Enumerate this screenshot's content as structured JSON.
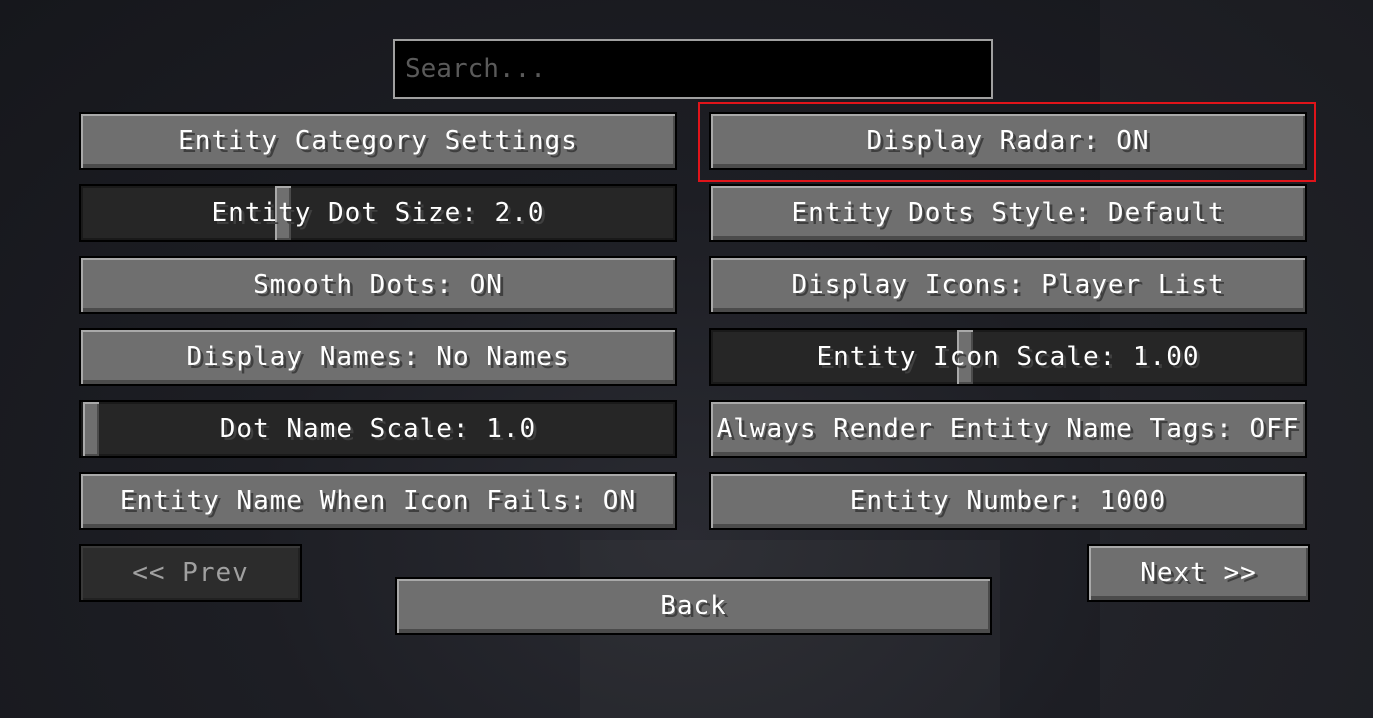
{
  "search": {
    "placeholder": "Search..."
  },
  "left_column": [
    {
      "label": "Entity Category Settings"
    },
    {
      "label": "Entity Dot Size: 2.0",
      "slider_value": 0.33
    },
    {
      "label": "Smooth Dots: ON"
    },
    {
      "label": "Display Names: No Names"
    },
    {
      "label": "Dot Name Scale: 1.0",
      "slider_value": 0.0
    },
    {
      "label": "Entity Name When Icon Fails: ON"
    }
  ],
  "right_column": [
    {
      "label": "Display Radar: ON",
      "highlighted": true
    },
    {
      "label": "Entity Dots Style: Default"
    },
    {
      "label": "Display Icons: Player List"
    },
    {
      "label": "Entity Icon Scale: 1.00",
      "slider_value": 0.42
    },
    {
      "label": "Always Render Entity Name Tags: OFF"
    },
    {
      "label": "Entity Number: 1000"
    }
  ],
  "nav": {
    "prev_label": "<< Prev",
    "prev_enabled": false,
    "next_label": "Next >>",
    "back_label": "Back"
  },
  "colors": {
    "highlight_border": "#e0141a",
    "button_face": "#6f6f6f",
    "slider_track": "#262626"
  }
}
